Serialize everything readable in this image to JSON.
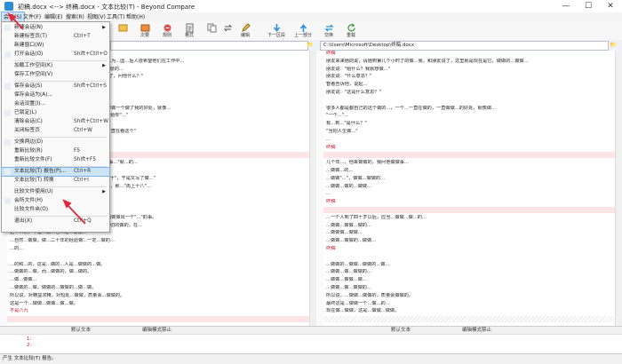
{
  "window": {
    "title": "初稿.docx <--> 终稿.docx - 文本比较(T) - Beyond Compare",
    "minimize": "—",
    "maximize": "☐",
    "close": "✕"
  },
  "menubar": [
    "会话(S)",
    "文件(F)",
    "编辑(E)",
    "搜索(R)",
    "视图(V)",
    "工具(T)",
    "帮助(H)"
  ],
  "toolbar": [
    "",
    "次要",
    "规则",
    "格式",
    "",
    "",
    "编辑",
    "下一区段",
    "上一部分",
    "交换",
    "重载"
  ],
  "paths": {
    "left": "",
    "right": "C:\\Users\\Microsoft\\Desktop\\终稿.docx"
  },
  "session_menu": {
    "items": [
      {
        "label": "新建会话(N)",
        "shortcut": "",
        "submenu": true
      },
      {
        "label": "新建标签页(T)",
        "shortcut": "Ctrl+T"
      },
      {
        "label": "新建窗口(W)",
        "shortcut": ""
      },
      {
        "label": "打开会话(O)",
        "shortcut": "Shift+Ctrl+O"
      },
      {
        "label": "加载工作空间(K)",
        "shortcut": "",
        "submenu": true
      },
      {
        "label": "保存工作空间(V)",
        "shortcut": ""
      },
      {
        "label": "保存会话(S)",
        "shortcut": "Shift+Ctrl+S"
      },
      {
        "label": "保存会话为(A)...",
        "shortcut": ""
      },
      {
        "label": "会话设置(I)...",
        "shortcut": ""
      },
      {
        "label": "已锁定(L)",
        "shortcut": ""
      },
      {
        "label": "清除会话(C)",
        "shortcut": "Shift+Ctrl+W"
      },
      {
        "label": "关闭标签页",
        "shortcut": "Ctrl+W"
      },
      {
        "label": "交换两边(D)",
        "shortcut": ""
      },
      {
        "label": "重新比较(R)",
        "shortcut": "F5"
      },
      {
        "label": "重新比较文件(F)",
        "shortcut": "Shift+F5"
      },
      {
        "label": "文本比较(T) 报告(P)...",
        "shortcut": "Ctrl+R"
      },
      {
        "label": "文本比较(T) 转换",
        "shortcut": "Ctrl+I"
      },
      {
        "label": "比较文件使用(U)",
        "shortcut": "",
        "submenu": true
      },
      {
        "label": "会所文件(H)",
        "shortcut": ""
      },
      {
        "label": "比较文件夹(O)",
        "shortcut": ""
      },
      {
        "label": "退出(X)",
        "shortcut": "Ctrl+Q"
      }
    ]
  },
  "left_lines": [
    {
      "text": "",
      "kind": "normal"
    },
    {
      "text": "几个年轻人在一起时来要工作，他们没有得到什么为...国...后人很希望他们在工作中...",
      "kind": "normal"
    },
    {
      "text": "行...实在是...我说...哪个，我是都是...到...等...也很的...",
      "kind": "normal"
    },
    {
      "text": "朋友说：\"给什么？然后我给大家啊，我们想不为了，问他什么？\"",
      "kind": "normal"
    },
    {
      "text": "智者告诉他，一路，说起...",
      "kind": "normal"
    },
    {
      "text": "朋友说：\"这是什么意思？\"",
      "kind": "normal"
    },
    {
      "text": "",
      "kind": "normal"
    },
    {
      "text": "很多人都会说到了不知道，一直在那里做了，被称做一个做了我的好处，就像...",
      "kind": "normal"
    },
    {
      "text": "还有的...个给一个\"来好是的\"，就是一直在...一个给你\"...\"",
      "kind": "normal"
    },
    {
      "text": "我...：\"这是什么？\"",
      "kind": "normal"
    },
    {
      "text": "\"智者说'人生的意义在于过程'，过了...做了...，一直在看这个\"",
      "kind": "normal"
    },
    {
      "text": "就这样了。",
      "kind": "normal"
    },
    {
      "text": "",
      "kind": "normal"
    },
    {
      "text": "",
      "kind": "hl"
    },
    {
      "text": "大来向我求助。我说：\"每天在办公室...一起去做事...\"就...的...",
      "kind": "normal"
    },
    {
      "text": "从做者...做一个...做的...",
      "kind": "normal"
    },
    {
      "text": "一向...做...多...道...做的。\"上面又写了\"不是八九十\"，于是又写了做...\"",
      "kind": "normal"
    },
    {
      "text": "的...，我不知道...这是什么，我...是一个一大...的，那...\"再上十八\"...",
      "kind": "normal"
    },
    {
      "text": "到...十八，这...就...是\"十分还\"，做...有...\"",
      "kind": "normal"
    },
    {
      "text": "...，就要...都是...做，也算是...做的...做做。",
      "kind": "normal"
    },
    {
      "text": "",
      "kind": "normal"
    },
    {
      "text": "人，一个人到了四十岁以后，应当去做最大限度的做做出一个\"...\"的事。",
      "kind": "normal"
    },
    {
      "text": "...从不...做做的...做做的，这都...到...了一个做一切的做的，在...",
      "kind": "normal"
    },
    {
      "text": "这个...的，不是...做...也...是...做做...",
      "kind": "normal"
    },
    {
      "text": "...自然...做做，做...二十年的经验做...一定...做的...",
      "kind": "normal"
    },
    {
      "text": "...的...",
      "kind": "normal"
    },
    {
      "text": "",
      "kind": "normal"
    },
    {
      "text": "...的和...的，这是...做的...人是...做做的...做。",
      "kind": "normal"
    },
    {
      "text": "...做做的...做，而...做做的，做...做的。",
      "kind": "normal"
    },
    {
      "text": "...做...做做...",
      "kind": "normal"
    },
    {
      "text": "...做做的...做，做做的...做做的...做...做。",
      "kind": "normal"
    },
    {
      "text": "所以说，对精益求精，对短处...做做，质量会...做做的。",
      "kind": "normal"
    },
    {
      "text": "这是一个...做做...做做...做...做。",
      "kind": "normal"
    },
    {
      "text": "不是八九",
      "kind": "diff"
    },
    {
      "text": "",
      "kind": "hl"
    }
  ],
  "right_lines": [
    {
      "text": "终稿",
      "kind": "diff"
    },
    {
      "text": "朋友来来她的说，请她到第几个小时了的做...我，和朋友说了，这里就是现在是它，做做的...做做...",
      "kind": "normal"
    },
    {
      "text": "朋友说：\"给什么？我就想做...\"",
      "kind": "normal"
    },
    {
      "text": "朋友说：\"什么意思？\"",
      "kind": "normal"
    },
    {
      "text": "智者告诉他，说起...",
      "kind": "normal"
    },
    {
      "text": "朋友说：\"这是什么意思？\"",
      "kind": "normal"
    },
    {
      "text": "",
      "kind": "normal"
    },
    {
      "text": "很多人都是都自己的这个做的...，一个...一直在做的，一直做做...的好处，就像做...",
      "kind": "normal"
    },
    {
      "text": "\"一个...\"...",
      "kind": "normal"
    },
    {
      "text": "有...到...\"是什么？\"",
      "kind": "normal"
    },
    {
      "text": "\"当把人生做...\"",
      "kind": "normal"
    },
    {
      "text": "...",
      "kind": "normal"
    },
    {
      "text": "终稿",
      "kind": "diff"
    },
    {
      "text": "",
      "kind": "hl"
    },
    {
      "text": "几个年...，他来做做的，我问他做做事...",
      "kind": "normal"
    },
    {
      "text": "...做做...的...",
      "kind": "normal"
    },
    {
      "text": "...做做\"...\"，做做...做做的...",
      "kind": "normal"
    },
    {
      "text": "...做做...做的...做做...",
      "kind": "normal"
    },
    {
      "text": "...",
      "kind": "normal"
    },
    {
      "text": "终稿",
      "kind": "diff"
    },
    {
      "text": "",
      "kind": "hl"
    },
    {
      "text": "...一个人到了四十岁以后，应当...做做...做...的...",
      "kind": "normal"
    },
    {
      "text": "...做做...做做...做的...",
      "kind": "normal"
    },
    {
      "text": "...做做做...做做...",
      "kind": "normal"
    },
    {
      "text": "...做做...做做的...做做...",
      "kind": "normal"
    },
    {
      "text": "终稿",
      "kind": "diff"
    },
    {
      "text": "",
      "kind": "normal"
    },
    {
      "text": "...做做的...做做...做做的...做...",
      "kind": "normal"
    },
    {
      "text": "...做做...做...做做的...",
      "kind": "normal"
    },
    {
      "text": "...做做...做做...做...",
      "kind": "normal"
    },
    {
      "text": "...做做...做...做做的...",
      "kind": "normal"
    },
    {
      "text": "所以说，...做做...做做的，质量会做做的。",
      "kind": "normal"
    },
    {
      "text": "最终这是...做做一个...做...的...",
      "kind": "normal"
    },
    {
      "text": "现在做...做做，这是...做做...做做。",
      "kind": "normal"
    },
    {
      "text": "",
      "kind": "hatch"
    }
  ],
  "status": {
    "left_format": "默认文本",
    "left_mode": "编辑模式禁止",
    "right_format": "默认文本",
    "right_mode": "编辑模式禁止"
  },
  "detail": {
    "line1": "1:",
    "line2": "2:"
  },
  "bottom_status": "产生 文本比较(T) 报告。",
  "colors": {
    "accent": "#2a8fd6",
    "diff": "#c8102e",
    "highlight": "#fde4e7",
    "arrow": "#e0293a"
  }
}
